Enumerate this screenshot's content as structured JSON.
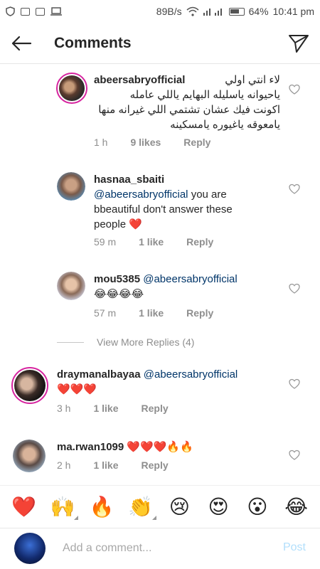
{
  "status_bar": {
    "net_speed": "89B/s",
    "battery": "64%",
    "time": "10:41 pm"
  },
  "header": {
    "title": "Comments",
    "back_icon": "arrow-left-icon",
    "share_icon": "paper-plane-icon"
  },
  "comments": [
    {
      "username": "abeersabryofficial",
      "text_lines": [
        "لاء انتي اولي",
        "ياحيوانه ياسليله البهايم ياللي عامله",
        "اكونت فيك عشان تشتمي اللي غيرانه منها",
        "يامعوقه ياغيوره يامسكينه"
      ],
      "time": "1 h",
      "likes": "9 likes",
      "reply": "Reply"
    },
    {
      "username": "hasnaa_sbaiti",
      "mention": "@abeersabryofficial",
      "text_line1": " you are",
      "text_line2": "bbeautiful don't answer these",
      "text_line3": "people ❤️",
      "time": "59 m",
      "likes": "1 like",
      "reply": "Reply"
    },
    {
      "username": "mou5385",
      "mention": "@abeersabryofficial",
      "text_line2": "😂😂😂😂",
      "time": "57 m",
      "likes": "1 like",
      "reply": "Reply"
    },
    {
      "username": "draymanalbayaa",
      "mention": "@abeersabryofficial",
      "text_line2": "❤️❤️❤️",
      "time": "3 h",
      "likes": "1 like",
      "reply": "Reply"
    },
    {
      "username": "ma.rwan1099",
      "text": " ❤️❤️❤️🔥🔥",
      "time": "2 h",
      "likes": "1 like",
      "reply": "Reply"
    }
  ],
  "view_more_replies": "View More Replies (4)",
  "emoji_bar": [
    "❤️",
    "🙌",
    "🔥",
    "👏",
    "😢",
    "😍",
    "😮",
    "😂"
  ],
  "composer": {
    "placeholder": "Add a comment...",
    "post_label": "Post"
  },
  "colors": {
    "mention": "#003569",
    "meta": "#8e8e8e",
    "post_disabled": "#b2dffc",
    "story_ring": "#d6249f"
  }
}
